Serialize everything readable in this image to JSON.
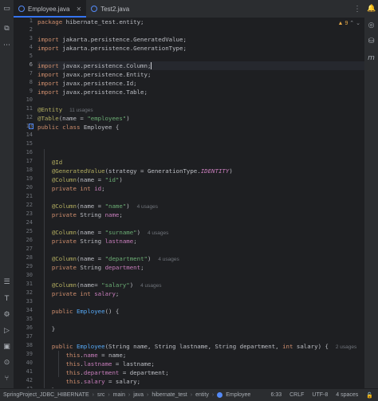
{
  "tabs": [
    {
      "label": "Employee.java",
      "active": true
    },
    {
      "label": "Test2.java",
      "active": false
    }
  ],
  "inspection": {
    "count": "9"
  },
  "code": {
    "l1": "hibernate_test.entity;",
    "l3a": "jakarta.persistence.GeneratedValue;",
    "l4a": "jakarta.persistence.GenerationType;",
    "l6a": "javax.persistence.Column;",
    "l7a": "javax.persistence.Entity;",
    "l8a": "javax.persistence.Id;",
    "l9a": "javax.persistence.Table;",
    "entity_hint": "11 usages",
    "table_name": "\"employees\"",
    "class_name": "Employee",
    "gen_strategy": "IDENTITY",
    "col_id": "\"id\"",
    "col_name": "\"name\"",
    "col_name_hint": "4 usages",
    "col_surname": "\"surname\"",
    "col_surname_hint": "4 usages",
    "col_department": "\"department\"",
    "col_department_hint": "4 usages",
    "col_salary": "\"salary\"",
    "col_salary_hint": "4 usages",
    "ctor_hint": "2 usages"
  },
  "statusbar": {
    "crumbs": [
      "SpringProject_JDBC_HIBERNATE",
      "src",
      "main",
      "java",
      "hibernate_test",
      "entity",
      "Employee"
    ],
    "position": "6:33",
    "line_sep": "CRLF",
    "encoding": "UTF-8",
    "indent": "4 spaces"
  },
  "colors": {
    "accent": "#3574f0",
    "keyword": "#cf8e6d",
    "annotation": "#b3ae60",
    "string": "#6aab73",
    "field": "#c77dbb",
    "method": "#56a8f5"
  }
}
